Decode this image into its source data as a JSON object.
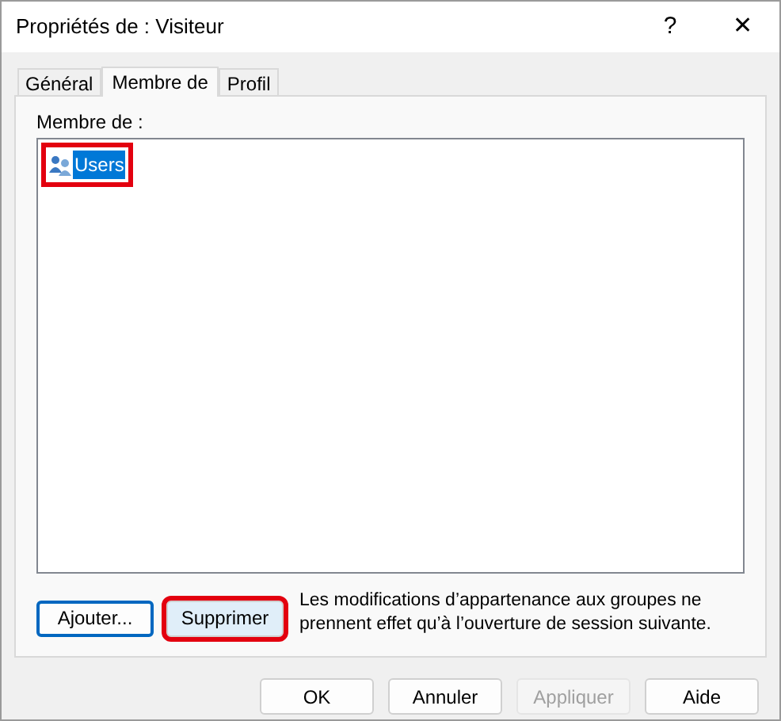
{
  "window": {
    "title": "Propriétés de : Visiteur",
    "help": "?",
    "close": "✕"
  },
  "tabs": [
    {
      "label": "Général",
      "selected": false
    },
    {
      "label": "Membre de",
      "selected": true
    },
    {
      "label": "Profil",
      "selected": false
    }
  ],
  "members": {
    "label": "Membre de :",
    "items": [
      {
        "name": "Users",
        "selected": true,
        "highlighted": true
      }
    ]
  },
  "actions": [
    {
      "label": "Ajouter...",
      "focused": true,
      "highlighted": false
    },
    {
      "label": "Supprimer",
      "focused": false,
      "highlighted": true
    }
  ],
  "note": "Les modifications d’appartenance aux groupes ne prennent effet qu’à l’ouverture de session suivante.",
  "buttons": [
    {
      "label": "OK",
      "disabled": false
    },
    {
      "label": "Annuler",
      "disabled": false
    },
    {
      "label": "Appliquer",
      "disabled": true
    },
    {
      "label": "Aide",
      "disabled": false
    }
  ]
}
